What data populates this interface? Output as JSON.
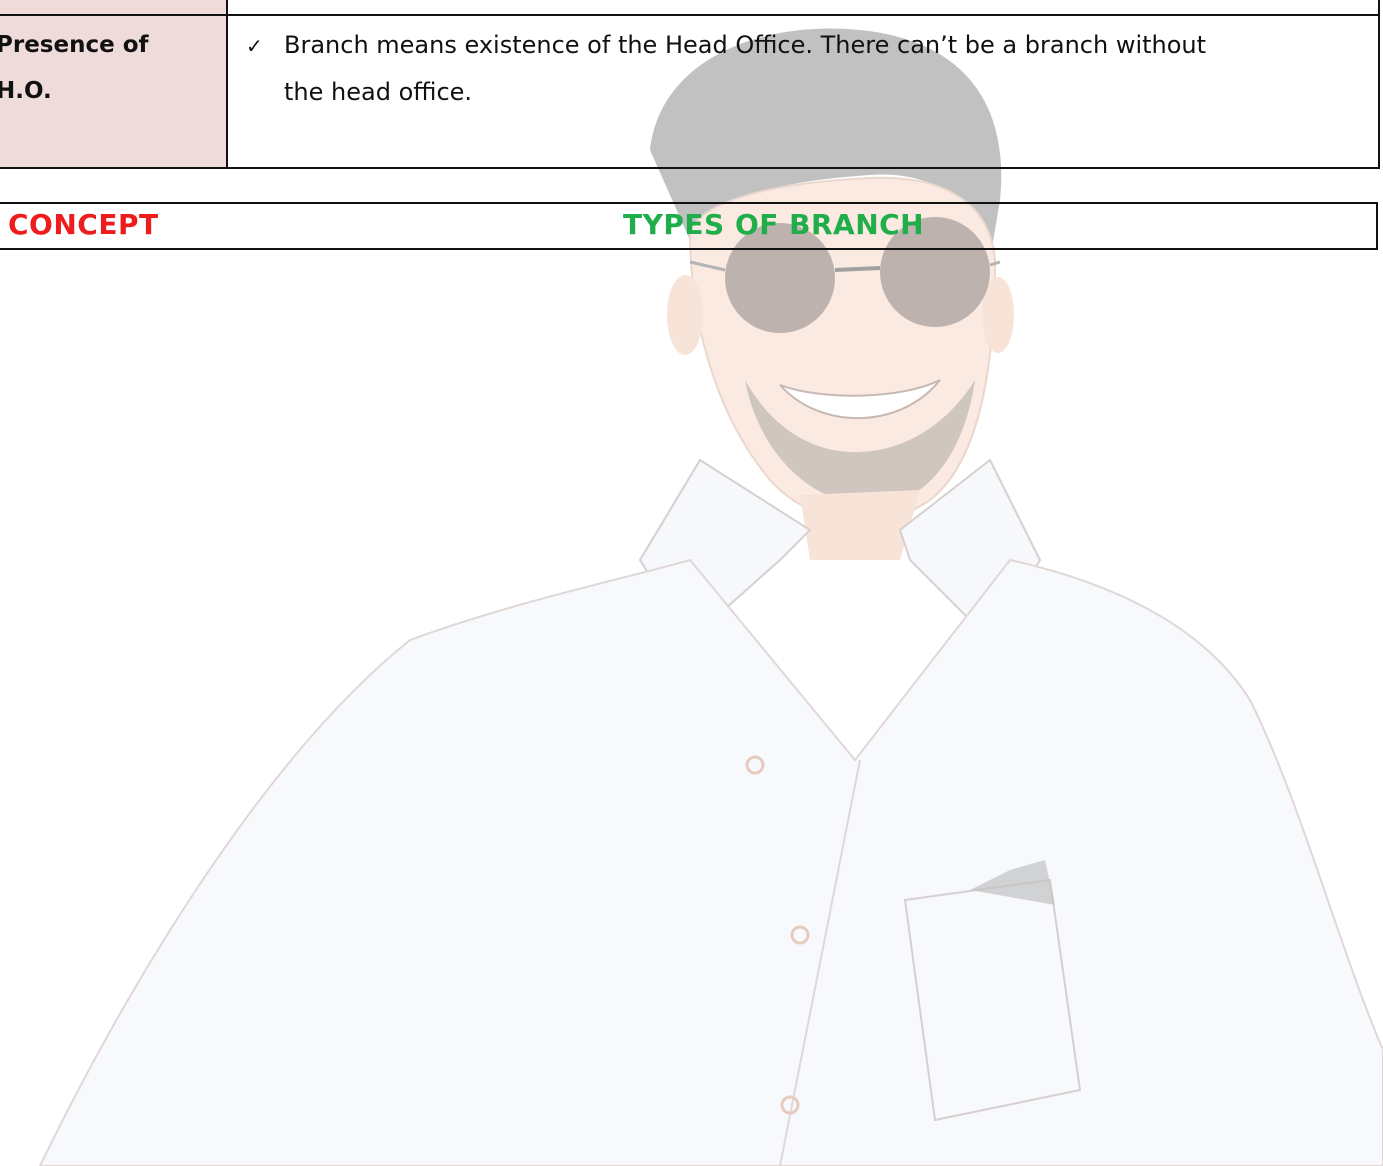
{
  "table": {
    "rows": [
      {
        "heading_line1": "Presence of",
        "heading_line2": "H.O.",
        "bullet": "✓",
        "text_line1": "Branch means existence of the Head Office. There can’t be a branch without",
        "text_line2": "the head office."
      }
    ]
  },
  "concept": {
    "label": "CONCEPT",
    "title": "TYPES OF BRANCH",
    "label_color": "#ee1c1c",
    "title_color": "#1fae4a"
  },
  "watermark": {
    "icon": "portrait-watermark-icon"
  }
}
